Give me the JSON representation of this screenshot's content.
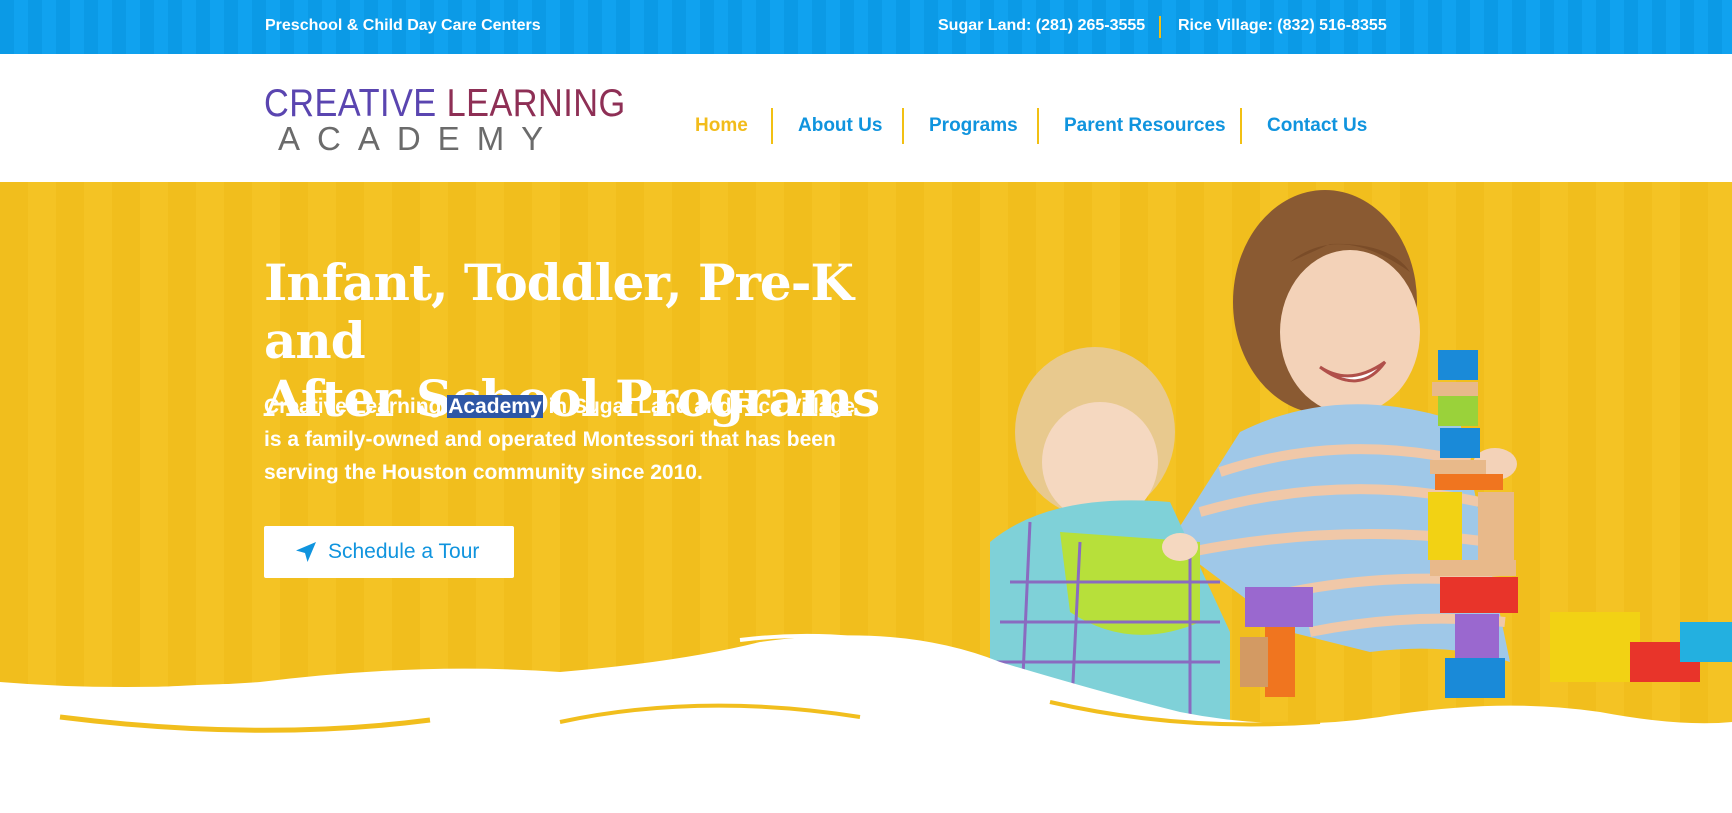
{
  "topbar": {
    "tagline": "Preschool & Child Day Care Centers",
    "phone_sugar_land": "Sugar Land: (281) 265-3555",
    "phone_rice_village": "Rice Village: (832) 516-8355"
  },
  "logo": {
    "word1": "CREATIVE",
    "word2": "LEARNING",
    "word3": "ACADEMY"
  },
  "nav": {
    "items": [
      {
        "label": "Home"
      },
      {
        "label": "About Us"
      },
      {
        "label": "Programs"
      },
      {
        "label": "Parent Resources"
      },
      {
        "label": "Contact Us"
      }
    ]
  },
  "hero": {
    "heading_line1": "Infant, Toddler, Pre-K and",
    "heading_line2": "After School Programs",
    "desc_part1": "Creative Learning ",
    "desc_highlight": "Academy",
    "desc_part2": " in Sugar Land and Rice Village is a family-owned and operated Montessori that has been serving the Houston community since 2010.",
    "cta_label": "Schedule a Tour"
  },
  "colors": {
    "topbar_blue": "#0b9ae6",
    "nav_blue": "#1094de",
    "accent_yellow": "#f2c013",
    "logo_purple": "#5a45b0",
    "logo_maroon": "#8e2f55"
  }
}
